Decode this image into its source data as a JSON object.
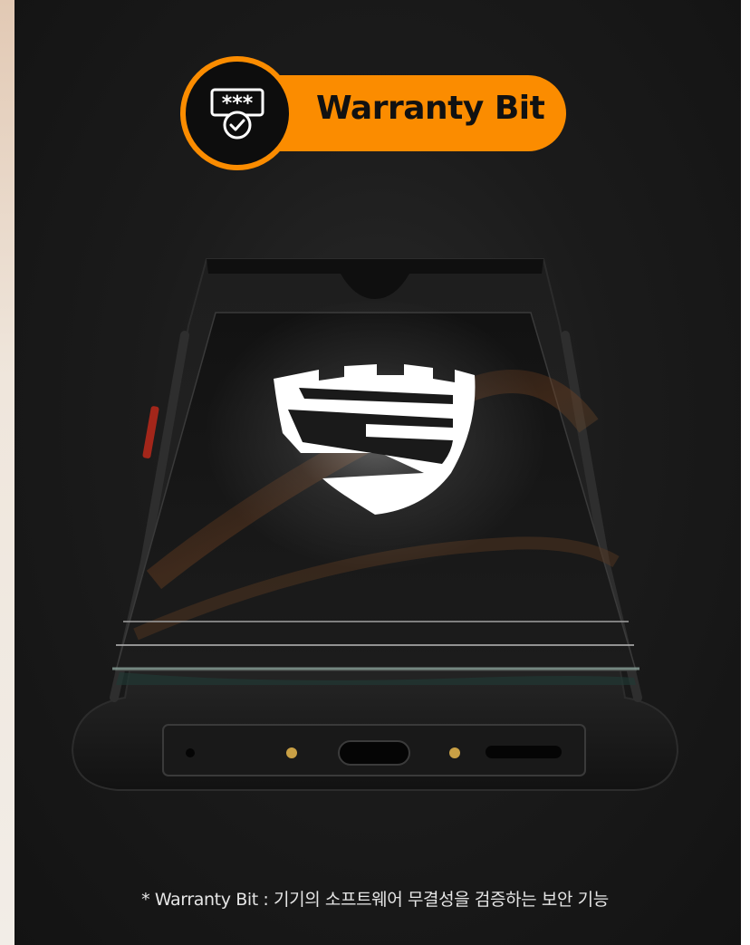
{
  "badge": {
    "label": "Warranty Bit",
    "icon": "password-verified-icon",
    "accent_color": "#fb8c00"
  },
  "phone": {
    "screen_icon": "knox-shield-icon"
  },
  "footnote": "* Warranty Bit : 기기의 소프트웨어 무결성을 검증하는 보안 기능"
}
